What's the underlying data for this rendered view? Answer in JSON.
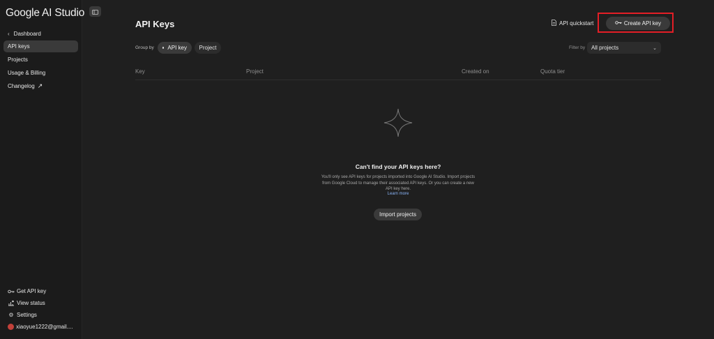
{
  "app": {
    "title": "Google AI Studio"
  },
  "sidebar": {
    "back_label": "Dashboard",
    "items": [
      {
        "label": "API keys"
      },
      {
        "label": "Projects"
      },
      {
        "label": "Usage & Billing"
      },
      {
        "label": "Changelog"
      }
    ],
    "footer": {
      "get_api_key": "Get API key",
      "view_status": "View status",
      "settings": "Settings",
      "account": "xiaoyue1222@gmail...."
    }
  },
  "header": {
    "title": "API Keys",
    "quickstart_label": "API quickstart",
    "create_label": "Create API key"
  },
  "toolbar": {
    "group_by_label": "Group by",
    "group_options": [
      "API key",
      "Project"
    ],
    "filter_label": "Filter by",
    "filter_value": "All projects"
  },
  "table": {
    "columns": [
      "Key",
      "Project",
      "Created on",
      "Quota tier"
    ]
  },
  "empty_state": {
    "title": "Can't find your API keys here?",
    "description": "You'll only see API keys for projects imported into Google AI Studio. Import projects from Google Cloud to manage their associated API keys. Or you can create a new API key here.",
    "learn_more": "Learn more",
    "import_label": "Import projects"
  },
  "colors": {
    "background": "#1f1f1f",
    "highlight_box": "#e41e26",
    "link": "#8ab4f8"
  }
}
